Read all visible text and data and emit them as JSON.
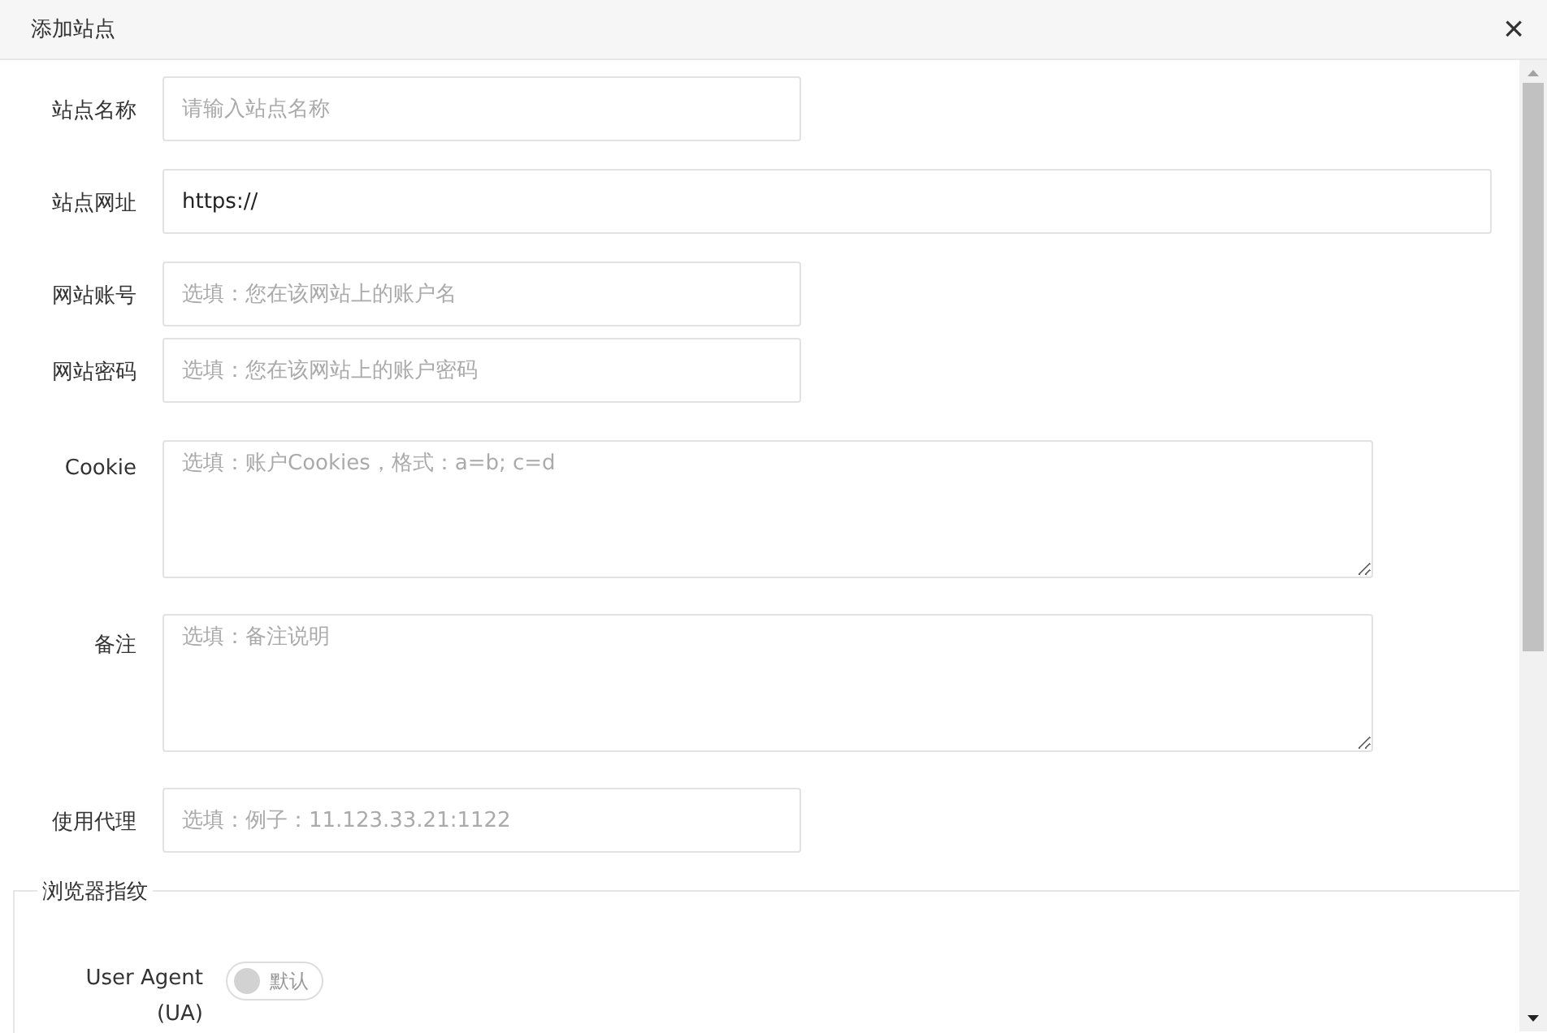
{
  "dialog": {
    "title": "添加站点",
    "close": "×"
  },
  "fields": [
    {
      "label": "站点名称",
      "kind": "input",
      "placeholder": "请输入站点名称"
    },
    {
      "label": "站点网址",
      "kind": "input",
      "value": "https://"
    },
    {
      "label": "网站账号",
      "kind": "input",
      "placeholder": "选填：您在该网站上的账户名"
    },
    {
      "label": "网站密码",
      "kind": "input",
      "placeholder": "选填：您在该网站上的账户密码"
    },
    {
      "label": "Cookie",
      "kind": "textarea",
      "placeholder": "选填：账户Cookies，格式：a=b; c=d"
    },
    {
      "label": "备注",
      "kind": "textarea",
      "placeholder": "选填：备注说明"
    },
    {
      "label": "使用代理",
      "kind": "input",
      "placeholder": "选填：例子：11.123.33.21:1122"
    }
  ],
  "fingerprint": {
    "legend": "浏览器指纹",
    "user_agent": {
      "label": "User Agent (UA)",
      "toggle_text": "默认",
      "on": false
    }
  }
}
